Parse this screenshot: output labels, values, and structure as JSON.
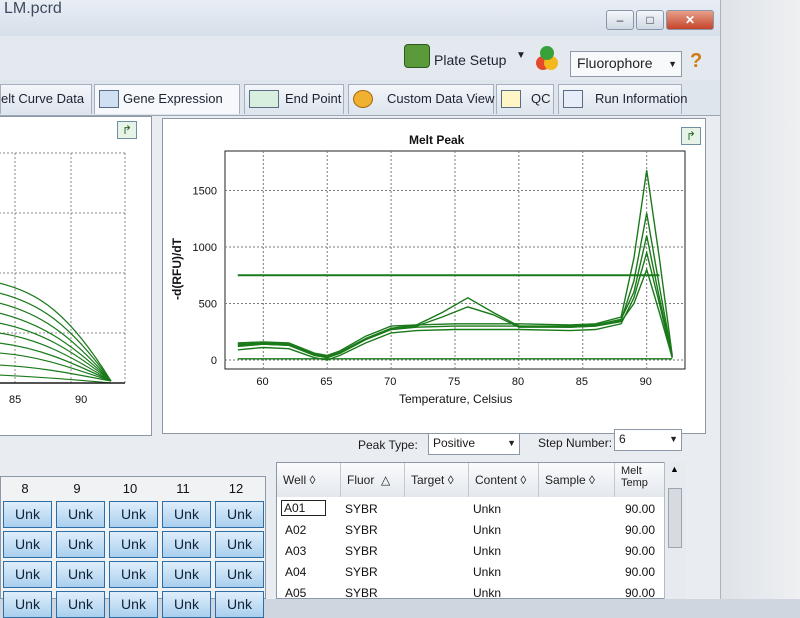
{
  "window": {
    "title": "LM.pcrd",
    "min": "–",
    "max": "□",
    "close": "✕"
  },
  "toolbar": {
    "plate_setup": "Plate Setup",
    "fluorophore": "Fluorophore",
    "help": "?"
  },
  "tabs": [
    "elt Curve Data",
    "Gene Expression",
    "End Point",
    "Custom Data View",
    "QC",
    "Run Information"
  ],
  "left_chart": {
    "x_ticks": [
      "85",
      "90"
    ]
  },
  "chart_data": {
    "type": "line",
    "title": "Melt Peak",
    "xlabel": "Temperature, Celsius",
    "ylabel": "-d(RFU)/dT",
    "x_ticks": [
      60,
      65,
      70,
      75,
      80,
      85,
      90
    ],
    "y_ticks": [
      0,
      500,
      1000,
      1500
    ],
    "xlim": [
      57,
      93
    ],
    "ylim": [
      -80,
      1850
    ],
    "threshold": 750,
    "series": [
      {
        "x": [
          58,
          60,
          62,
          64,
          65,
          66,
          68,
          70,
          72,
          75,
          78,
          80,
          84,
          86,
          88,
          89,
          90,
          91,
          92
        ],
        "y": [
          150,
          160,
          150,
          60,
          40,
          80,
          210,
          300,
          310,
          320,
          320,
          320,
          310,
          320,
          380,
          900,
          1680,
          900,
          40
        ]
      },
      {
        "x": [
          58,
          60,
          62,
          64,
          65,
          66,
          68,
          70,
          72,
          75,
          78,
          80,
          84,
          86,
          88,
          89,
          90,
          91,
          92
        ],
        "y": [
          120,
          140,
          130,
          40,
          20,
          60,
          180,
          270,
          290,
          300,
          300,
          300,
          290,
          300,
          350,
          700,
          1300,
          650,
          30
        ]
      },
      {
        "x": [
          58,
          60,
          62,
          64,
          65,
          66,
          68,
          70,
          72,
          75,
          78,
          80,
          84,
          86,
          88,
          89,
          90,
          91,
          92
        ],
        "y": [
          90,
          110,
          100,
          20,
          0,
          40,
          150,
          240,
          260,
          270,
          270,
          270,
          260,
          270,
          320,
          550,
          950,
          500,
          20
        ]
      },
      {
        "x": [
          58,
          60,
          62,
          64,
          65,
          66,
          68,
          70,
          72,
          74,
          76,
          78,
          80,
          84,
          86,
          88,
          89,
          90,
          91,
          92
        ],
        "y": [
          140,
          150,
          140,
          50,
          30,
          70,
          190,
          280,
          310,
          420,
          550,
          420,
          300,
          300,
          310,
          360,
          600,
          1100,
          550,
          30
        ]
      },
      {
        "x": [
          58,
          60,
          62,
          64,
          65,
          66,
          68,
          70,
          72,
          74,
          76,
          78,
          80,
          84,
          86,
          88,
          89,
          90,
          91,
          92
        ],
        "y": [
          130,
          140,
          130,
          50,
          20,
          60,
          180,
          270,
          300,
          380,
          470,
          400,
          290,
          290,
          300,
          340,
          500,
          800,
          420,
          20
        ]
      },
      {
        "x": [
          58,
          92
        ],
        "y": [
          10,
          10
        ]
      }
    ]
  },
  "controls": {
    "peak_type_label": "Peak Type:",
    "peak_type": "Positive",
    "step_label": "Step Number:",
    "step": "6"
  },
  "plate": {
    "columns": [
      "8",
      "9",
      "10",
      "11",
      "12"
    ],
    "cell": "Unk"
  },
  "table": {
    "headers": [
      "Well",
      "Fluor",
      "Target",
      "Content",
      "Sample",
      "Melt Temp"
    ],
    "rows": [
      [
        "A01",
        "SYBR",
        "",
        "Unkn",
        "",
        "90.00"
      ],
      [
        "A02",
        "SYBR",
        "",
        "Unkn",
        "",
        "90.00"
      ],
      [
        "A03",
        "SYBR",
        "",
        "Unkn",
        "",
        "90.00"
      ],
      [
        "A04",
        "SYBR",
        "",
        "Unkn",
        "",
        "90.00"
      ],
      [
        "A05",
        "SYBR",
        "",
        "Unkn",
        "",
        "90.00"
      ]
    ]
  },
  "colors": {
    "curve": "#1a7a1a",
    "grid": "#7a7a7a"
  }
}
